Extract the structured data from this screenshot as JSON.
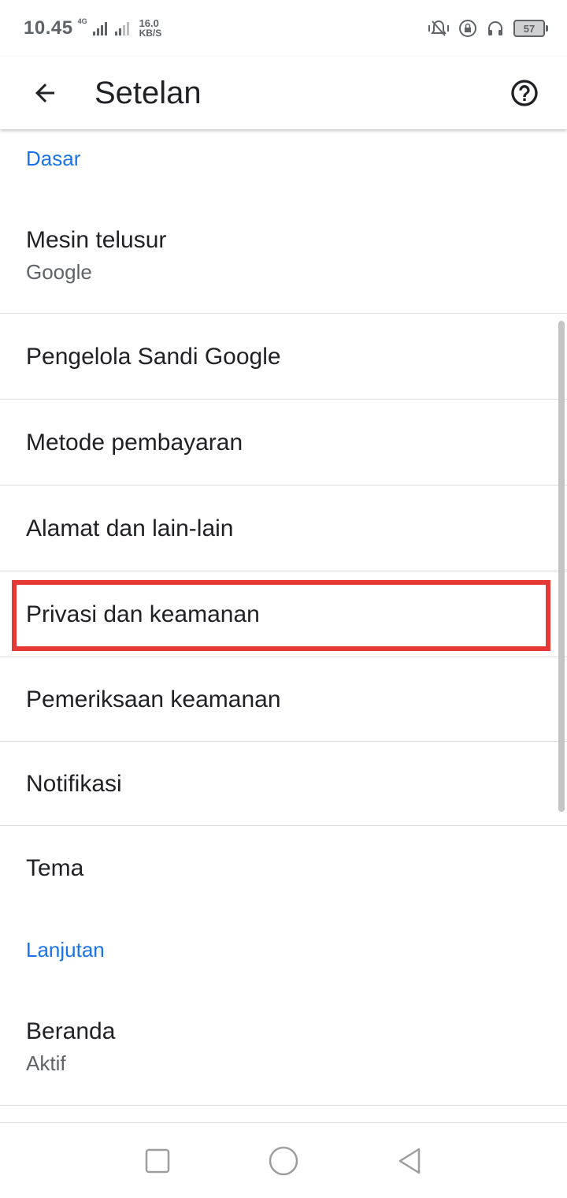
{
  "status_bar": {
    "time": "10.45",
    "network": "4G",
    "speed_value": "16.0",
    "speed_unit": "KB/S",
    "battery": "57",
    "icons": [
      "vibrate-icon",
      "lock-rotation-icon",
      "headphones-icon",
      "battery-icon"
    ]
  },
  "app_bar": {
    "title": "Setelan",
    "back_icon": "arrow-back-icon",
    "help_icon": "help-circle-icon"
  },
  "sections": {
    "basic": "Dasar",
    "advanced": "Lanjutan"
  },
  "items": {
    "search_engine": {
      "title": "Mesin telusur",
      "subtitle": "Google"
    },
    "password_manager": {
      "title": "Pengelola Sandi Google"
    },
    "payment_methods": {
      "title": "Metode pembayaran"
    },
    "addresses": {
      "title": "Alamat dan lain-lain"
    },
    "privacy": {
      "title": "Privasi dan keamanan"
    },
    "safety_check": {
      "title": "Pemeriksaan keamanan"
    },
    "notifications": {
      "title": "Notifikasi"
    },
    "theme": {
      "title": "Tema"
    },
    "homepage": {
      "title": "Beranda",
      "subtitle": "Aktif"
    }
  },
  "colors": {
    "accent": "#1a73e8",
    "highlight": "#e53935",
    "text_primary": "#202124",
    "text_secondary": "#5f6368"
  },
  "nav_bar": {
    "icons": [
      "recent-apps-icon",
      "home-icon",
      "back-nav-icon"
    ]
  }
}
